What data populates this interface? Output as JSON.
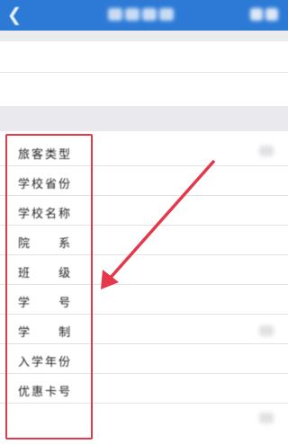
{
  "topbar": {
    "back_icon": "back-arrow-icon",
    "background": "#2c7ad6"
  },
  "form": {
    "rows": [
      {
        "label": "旅客类型"
      },
      {
        "label": "学校省份"
      },
      {
        "label": "学校名称"
      },
      {
        "label": "院 系"
      },
      {
        "label": "班 级"
      },
      {
        "label": "学 号"
      },
      {
        "label": "学 制"
      },
      {
        "label": "入学年份"
      },
      {
        "label": "优惠卡号"
      }
    ]
  },
  "annotation": {
    "box_color": "#e5384b",
    "arrow_color": "#e5384b"
  }
}
